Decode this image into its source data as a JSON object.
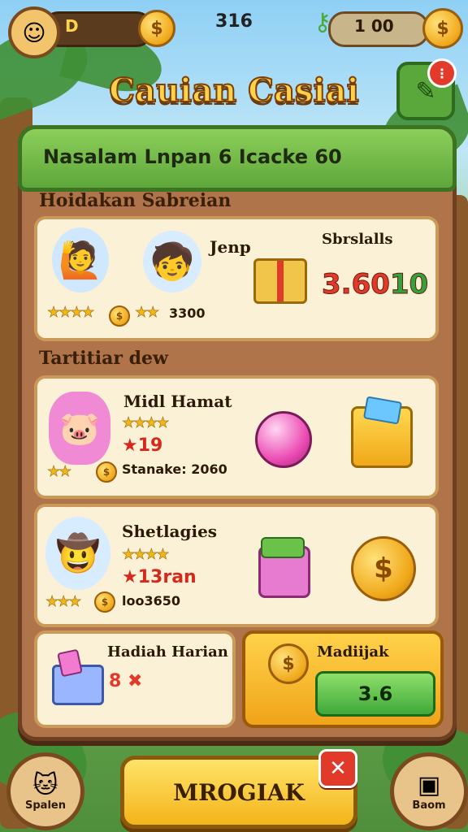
{
  "hud": {
    "left_value": "D",
    "center_score": "316",
    "right_value": "1 00",
    "coin_symbol": "$"
  },
  "title": "Cauian Casiai",
  "board": {
    "header": "Nasalam Lnpan 6 Icacke 60",
    "section1_label": "Hoidakan Sabreian",
    "section2_label": "Tartitiar dew"
  },
  "card1": {
    "char_label": "Jenp",
    "stat_label": "Sbrslalls",
    "price_red": "3.60",
    "price_green": "10",
    "stars_a": "★★★★",
    "stars_b": "★★",
    "value_b": "3300"
  },
  "card2": {
    "title": "Midl Hamat",
    "stars": "★★★★",
    "star_value": "★19",
    "stars_small": "★★",
    "info": "Stanake: 2060"
  },
  "card3": {
    "title": "Shetlagies",
    "stars": "★★★★",
    "star_value": "★13ran",
    "stars_small": "★★★",
    "info": "loo3650"
  },
  "daily": {
    "title": "Hadiah Harian",
    "glyphs": "8 ✖"
  },
  "offer": {
    "title": "Madiijak",
    "button": "3.6"
  },
  "buttons": {
    "main": "MROGIAK",
    "left_label": "Spalen",
    "right_label": "Baom",
    "close": "✕"
  },
  "colors": {
    "accent_green": "#5ea73a",
    "accent_gold": "#f0a81a",
    "board_wood": "#b0744a",
    "price_red": "#e23a2a"
  }
}
